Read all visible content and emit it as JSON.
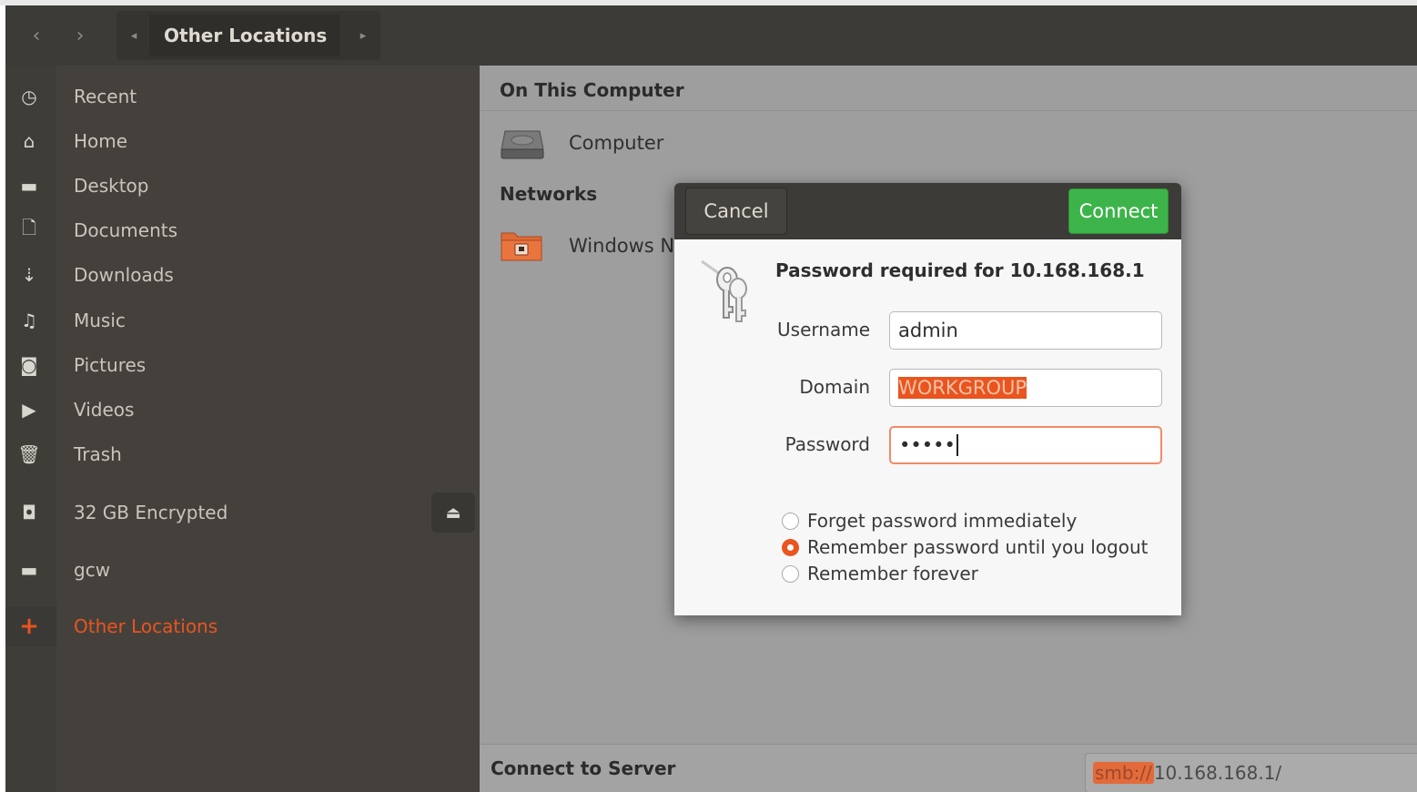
{
  "header": {
    "back_glyph": "‹",
    "forward_glyph": "›",
    "path_left_glyph": "◂",
    "path_right_glyph": "▸",
    "current_location": "Other Locations"
  },
  "sidebar": {
    "items": [
      {
        "label": "Recent",
        "icon": "clock-icon",
        "glyph": "◷"
      },
      {
        "label": "Home",
        "icon": "home-icon",
        "glyph": "⌂"
      },
      {
        "label": "Desktop",
        "icon": "folder-icon",
        "glyph": "▬"
      },
      {
        "label": "Documents",
        "icon": "document-icon",
        "glyph": "🗋"
      },
      {
        "label": "Downloads",
        "icon": "download-icon",
        "glyph": "⇣"
      },
      {
        "label": "Music",
        "icon": "music-icon",
        "glyph": "♫"
      },
      {
        "label": "Pictures",
        "icon": "camera-icon",
        "glyph": "◙"
      },
      {
        "label": "Videos",
        "icon": "video-icon",
        "glyph": "▶"
      },
      {
        "label": "Trash",
        "icon": "trash-icon",
        "glyph": "🗑"
      }
    ],
    "encrypted_drive": {
      "label": "32 GB Encrypted",
      "icon": "drive-icon",
      "glyph": "◘",
      "eject_glyph": "⏏"
    },
    "gcw": {
      "label": "gcw",
      "icon": "folder-icon",
      "glyph": "▬"
    },
    "other_locations": {
      "label": "Other Locations",
      "icon": "plus-icon",
      "glyph": "+"
    }
  },
  "content": {
    "on_this_computer": "On This Computer",
    "computer_label": "Computer",
    "networks": "Networks",
    "windows_network_label": "Windows Network",
    "connect_to_server": "Connect to Server",
    "server_scheme": "smb://",
    "server_rest": "10.168.168.1/"
  },
  "dialog": {
    "cancel": "Cancel",
    "connect": "Connect",
    "title": "Password required for 10.168.168.1",
    "username_label": "Username",
    "username_value": "admin",
    "domain_label": "Domain",
    "domain_value": "WORKGROUP",
    "password_label": "Password",
    "password_value": "•••••",
    "options": [
      {
        "label": "Forget password immediately",
        "checked": false
      },
      {
        "label": "Remember password until you logout",
        "checked": true
      },
      {
        "label": "Remember forever",
        "checked": false
      }
    ]
  },
  "colors": {
    "accent": "#e9541f",
    "connect_green": "#3cb44a",
    "headerbar": "#3c3b37",
    "sidebar": "#44413c"
  }
}
